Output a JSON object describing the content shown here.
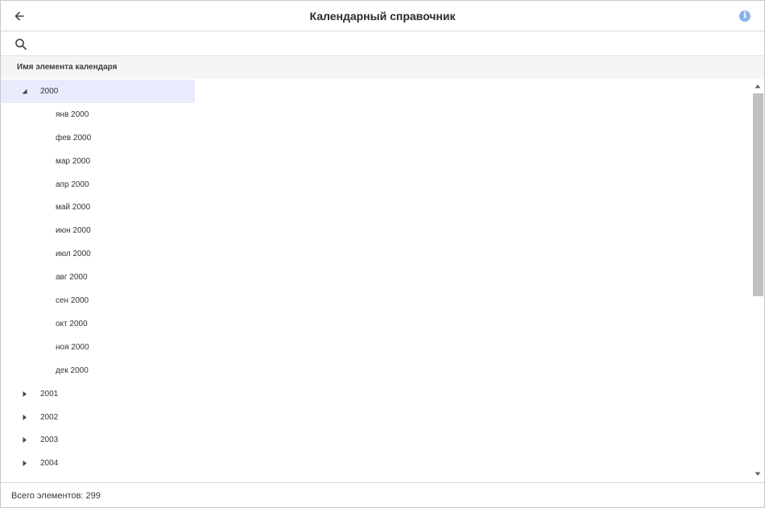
{
  "header": {
    "title": "Календарный справочник",
    "back_icon": "arrow-left-icon",
    "info_icon": "info-icon",
    "info_glyph": "i",
    "info_color": "#8ab4e8"
  },
  "search": {
    "icon": "search-icon",
    "value": "",
    "placeholder": ""
  },
  "column_header": {
    "label": "Имя элемента календаря"
  },
  "tree": {
    "selected_color": "#e8ebfb",
    "items": [
      {
        "label": "2000",
        "level": 0,
        "expanded": true,
        "selected": true
      },
      {
        "label": "янв 2000",
        "level": 1
      },
      {
        "label": "фев 2000",
        "level": 1
      },
      {
        "label": "мар 2000",
        "level": 1
      },
      {
        "label": "апр 2000",
        "level": 1
      },
      {
        "label": "май 2000",
        "level": 1
      },
      {
        "label": "июн 2000",
        "level": 1
      },
      {
        "label": "июл 2000",
        "level": 1
      },
      {
        "label": "авг 2000",
        "level": 1
      },
      {
        "label": "сен 2000",
        "level": 1
      },
      {
        "label": "окт 2000",
        "level": 1
      },
      {
        "label": "ноя 2000",
        "level": 1
      },
      {
        "label": "дек 2000",
        "level": 1
      },
      {
        "label": "2001",
        "level": 0,
        "expanded": false
      },
      {
        "label": "2002",
        "level": 0,
        "expanded": false
      },
      {
        "label": "2003",
        "level": 0,
        "expanded": false
      },
      {
        "label": "2004",
        "level": 0,
        "expanded": false
      }
    ]
  },
  "scrollbar": {
    "thumb_color": "#c1c1c1"
  },
  "footer": {
    "total_label": "Всего элементов: 299"
  }
}
